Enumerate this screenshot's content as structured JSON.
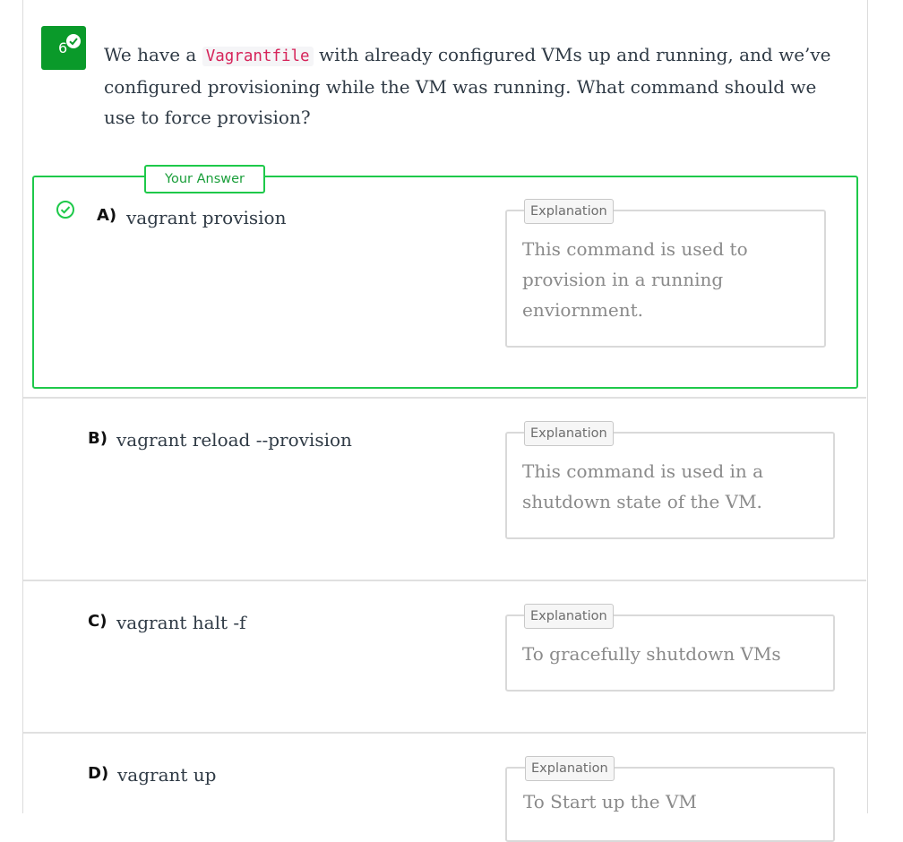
{
  "question": {
    "number": "6",
    "text_before": "We have a ",
    "code": "Vagrantfile",
    "text_after": " with already configured VMs up and running, and we’ve configured provisioning while the VM was running. What command should we use to force provision?"
  },
  "your_answer_label": "Your Answer",
  "explanation_label": "Explanation",
  "options": [
    {
      "letter": "A)",
      "text": "vagrant provision",
      "explanation": "This command is used to provision in a running enviornment.",
      "selected": true,
      "correct": true
    },
    {
      "letter": "B)",
      "text": "vagrant reload --provision",
      "explanation": "This command is used in a shutdown state of the VM."
    },
    {
      "letter": "C)",
      "text": "vagrant halt -f",
      "explanation": "To gracefully shutdown VMs"
    },
    {
      "letter": "D)",
      "text": "vagrant up",
      "explanation": "To Start up the VM"
    }
  ],
  "colors": {
    "correct": "#1ec94a",
    "badge": "#0a9a2a",
    "code": "#d6245a"
  }
}
